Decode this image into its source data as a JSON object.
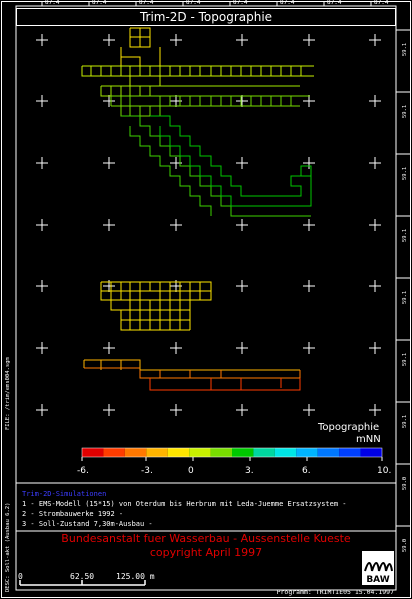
{
  "title": "Trim-2D - Topographie",
  "top_ticks": [
    "87.4",
    "87.4",
    "87.4",
    "87.4",
    "87.4",
    "87.4",
    "87.4",
    "87.4"
  ],
  "right_ticks": [
    "59.1",
    "59.1",
    "59.1",
    "59.1",
    "59.1",
    "59.1",
    "59.1",
    "59.0",
    "59.0"
  ],
  "colorbar": {
    "title": "Topographie",
    "unit": "mNN",
    "ticks": [
      "-6.",
      "-3.",
      "0",
      "3.",
      "6.",
      "10."
    ],
    "colors": [
      "#e00000",
      "#ff3c00",
      "#ff7800",
      "#ffb400",
      "#ffe600",
      "#c8f000",
      "#78dc00",
      "#00c800",
      "#00d7a0",
      "#00e6e6",
      "#00b4ff",
      "#0078ff",
      "#0040ff",
      "#0000e6"
    ]
  },
  "legend": {
    "heading": "Trim-2D-Simulationen",
    "items": [
      "1 - EMS-Modell (15*15) von Oterdum bis Herbrum mit Leda-Juemme Ersatzsystem -",
      "2 - Strombauwerke 1992 -",
      "3 - Soll-Zustand 7,30m-Ausbau -"
    ]
  },
  "credits": {
    "line1": "Bundesanstalt fuer Wasserbau - Aussenstelle Kueste",
    "line2": "copyright April 1997"
  },
  "scalebar": {
    "labels": [
      "0",
      "62.50",
      "125.00 m"
    ]
  },
  "logo_text": "BAW",
  "program": "Programm: TRIMTIE05 15.04.1997",
  "side_left": [
    "FILE: /trim/ems004.sgm",
    "DESC: Soll-akt (Ausbau 6.2)"
  ],
  "colors": {
    "background": "#000000",
    "frame": "#ffffff",
    "credit": "#e00000",
    "legend_heading": "#3c3cff"
  }
}
